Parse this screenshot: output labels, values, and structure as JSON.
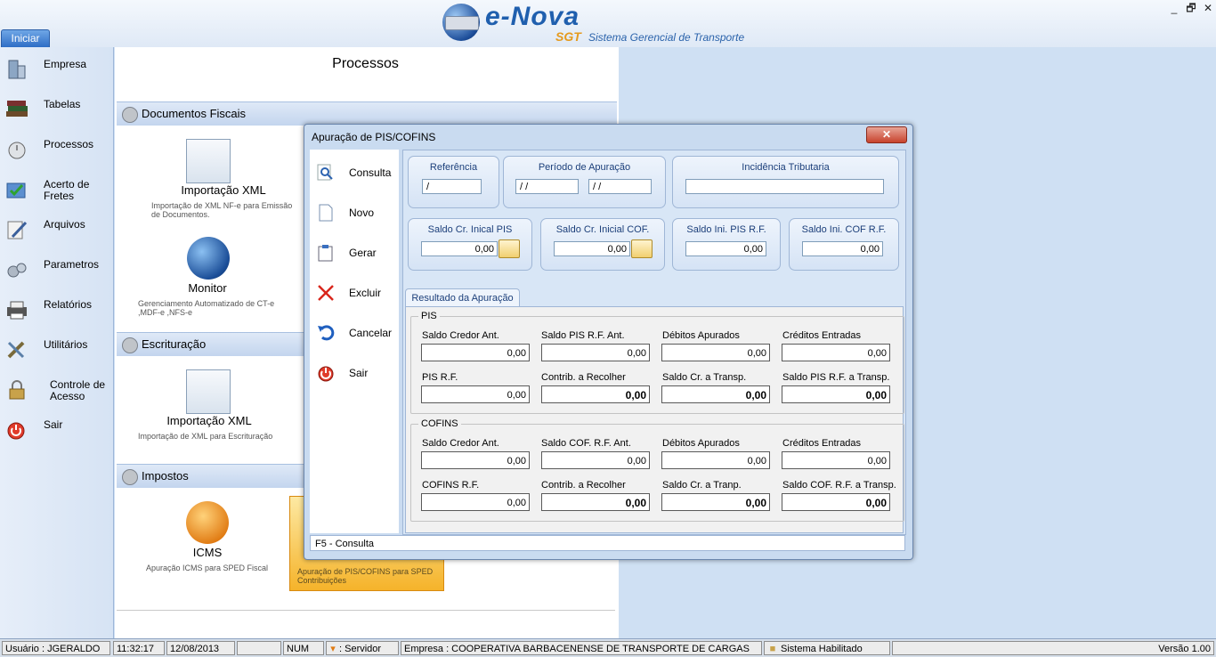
{
  "app": {
    "logo_text": "e-Nova",
    "logo_sgt": "SGT",
    "logo_subtitle": "Sistema Gerencial de Transporte",
    "window_buttons": [
      "_",
      "🗗",
      "✕"
    ],
    "start_tab": "Iniciar"
  },
  "sidebar": {
    "items": [
      {
        "label": "Empresa",
        "icon": "building-icon"
      },
      {
        "label": "Tabelas",
        "icon": "books-icon"
      },
      {
        "label": "Processos",
        "icon": "stopwatch-icon"
      },
      {
        "label": "Acerto de Fretes",
        "icon": "checkmark-document-icon"
      },
      {
        "label": "Arquivos",
        "icon": "document-pen-icon"
      },
      {
        "label": "Parametros",
        "icon": "gears-icon"
      },
      {
        "label": "Relatórios",
        "icon": "printer-icon"
      },
      {
        "label": "Utilitários",
        "icon": "tools-icon"
      },
      {
        "label": "Controle de Acesso",
        "icon": "padlock-icon"
      },
      {
        "label": "Sair",
        "icon": "power-icon"
      }
    ]
  },
  "panel": {
    "title": "Processos",
    "sections": [
      {
        "label": "Documentos Fiscais"
      },
      {
        "label": "Escrituração"
      },
      {
        "label": "Impostos"
      }
    ],
    "tiles": {
      "import_xml_1": {
        "title": "Importação XML",
        "desc": "Importação de XML NF-e para Emissão de Documentos."
      },
      "monitor": {
        "title": "Monitor",
        "desc": "Gerenciamento Automatizado de CT-e ,MDF-e ,NFS-e"
      },
      "import_xml_2": {
        "title": "Importação XML",
        "desc": "Importação de XML para Escrituração"
      },
      "icms": {
        "title": "ICMS",
        "desc": "Apuração ICMS para SPED Fiscal"
      },
      "pis_cofins": {
        "desc": "Apuração de PIS/COFINS para SPED Contribuições"
      }
    }
  },
  "modal": {
    "title": "Apuração de PIS/COFINS",
    "close": "✕",
    "toolbar": [
      {
        "label": "Consulta",
        "icon": "magnifier-icon"
      },
      {
        "label": "Novo",
        "icon": "new-document-icon"
      },
      {
        "label": "Gerar",
        "icon": "clipboard-icon"
      },
      {
        "label": "Excluir",
        "icon": "delete-x-icon"
      },
      {
        "label": "Cancelar",
        "icon": "undo-icon"
      },
      {
        "label": "Sair",
        "icon": "power-icon"
      }
    ],
    "header": {
      "referencia_label": "Referência",
      "referencia_value": " /",
      "periodo_label": "Período de Apuração",
      "periodo_inicio": " / /",
      "periodo_fim": " / /",
      "incidencia_label": "Incidência Tributaria",
      "incidencia_value": "",
      "saldo_pis_label": "Saldo Cr. Inical PIS",
      "saldo_pis_value": "0,00",
      "saldo_cof_label": "Saldo Cr. Inicial COF.",
      "saldo_cof_value": "0,00",
      "saldo_ini_pis_rf_label": "Saldo Ini. PIS R.F.",
      "saldo_ini_pis_rf_value": "0,00",
      "saldo_ini_cof_rf_label": "Saldo Ini. COF R.F.",
      "saldo_ini_cof_rf_value": "0,00"
    },
    "result_tab": "Resultado da Apuração",
    "pis": {
      "legend": "PIS",
      "fields": [
        {
          "label": "Saldo Credor Ant.",
          "value": "0,00",
          "bold": false
        },
        {
          "label": "Saldo PIS R.F. Ant.",
          "value": "0,00",
          "bold": false
        },
        {
          "label": "Débitos Apurados",
          "value": "0,00",
          "bold": false
        },
        {
          "label": "Créditos Entradas",
          "value": "0,00",
          "bold": false
        },
        {
          "label": "PIS R.F.",
          "value": "0,00",
          "bold": false
        },
        {
          "label": "Contrib. a Recolher",
          "value": "0,00",
          "bold": true
        },
        {
          "label": "Saldo Cr. a Transp.",
          "value": "0,00",
          "bold": true
        },
        {
          "label": "Saldo PIS R.F. a Transp.",
          "value": "0,00",
          "bold": true
        }
      ]
    },
    "cofins": {
      "legend": "COFINS",
      "fields": [
        {
          "label": "Saldo Credor Ant.",
          "value": "0,00",
          "bold": false
        },
        {
          "label": "Saldo COF. R.F. Ant.",
          "value": "0,00",
          "bold": false
        },
        {
          "label": "Débitos Apurados",
          "value": "0,00",
          "bold": false
        },
        {
          "label": "Créditos Entradas",
          "value": "0,00",
          "bold": false
        },
        {
          "label": "COFINS R.F.",
          "value": "0,00",
          "bold": false
        },
        {
          "label": "Contrib. a Recolher",
          "value": "0,00",
          "bold": true
        },
        {
          "label": "Saldo Cr. a Tranp.",
          "value": "0,00",
          "bold": true
        },
        {
          "label": "Saldo COF. R.F. a Transp.",
          "value": "0,00",
          "bold": true
        }
      ]
    },
    "status": "F5 - Consulta"
  },
  "statusbar": {
    "usuario": "Usuário : JGERALDO",
    "hora": "11:32:17",
    "data": "12/08/2013",
    "blank": "",
    "num": "NUM",
    "servidor": ": Servidor",
    "empresa": "Empresa : COOPERATIVA BARBACENENSE DE TRANSPORTE DE CARGAS",
    "sistema": "Sistema Habilitado",
    "versao": "Versão 1.00"
  }
}
